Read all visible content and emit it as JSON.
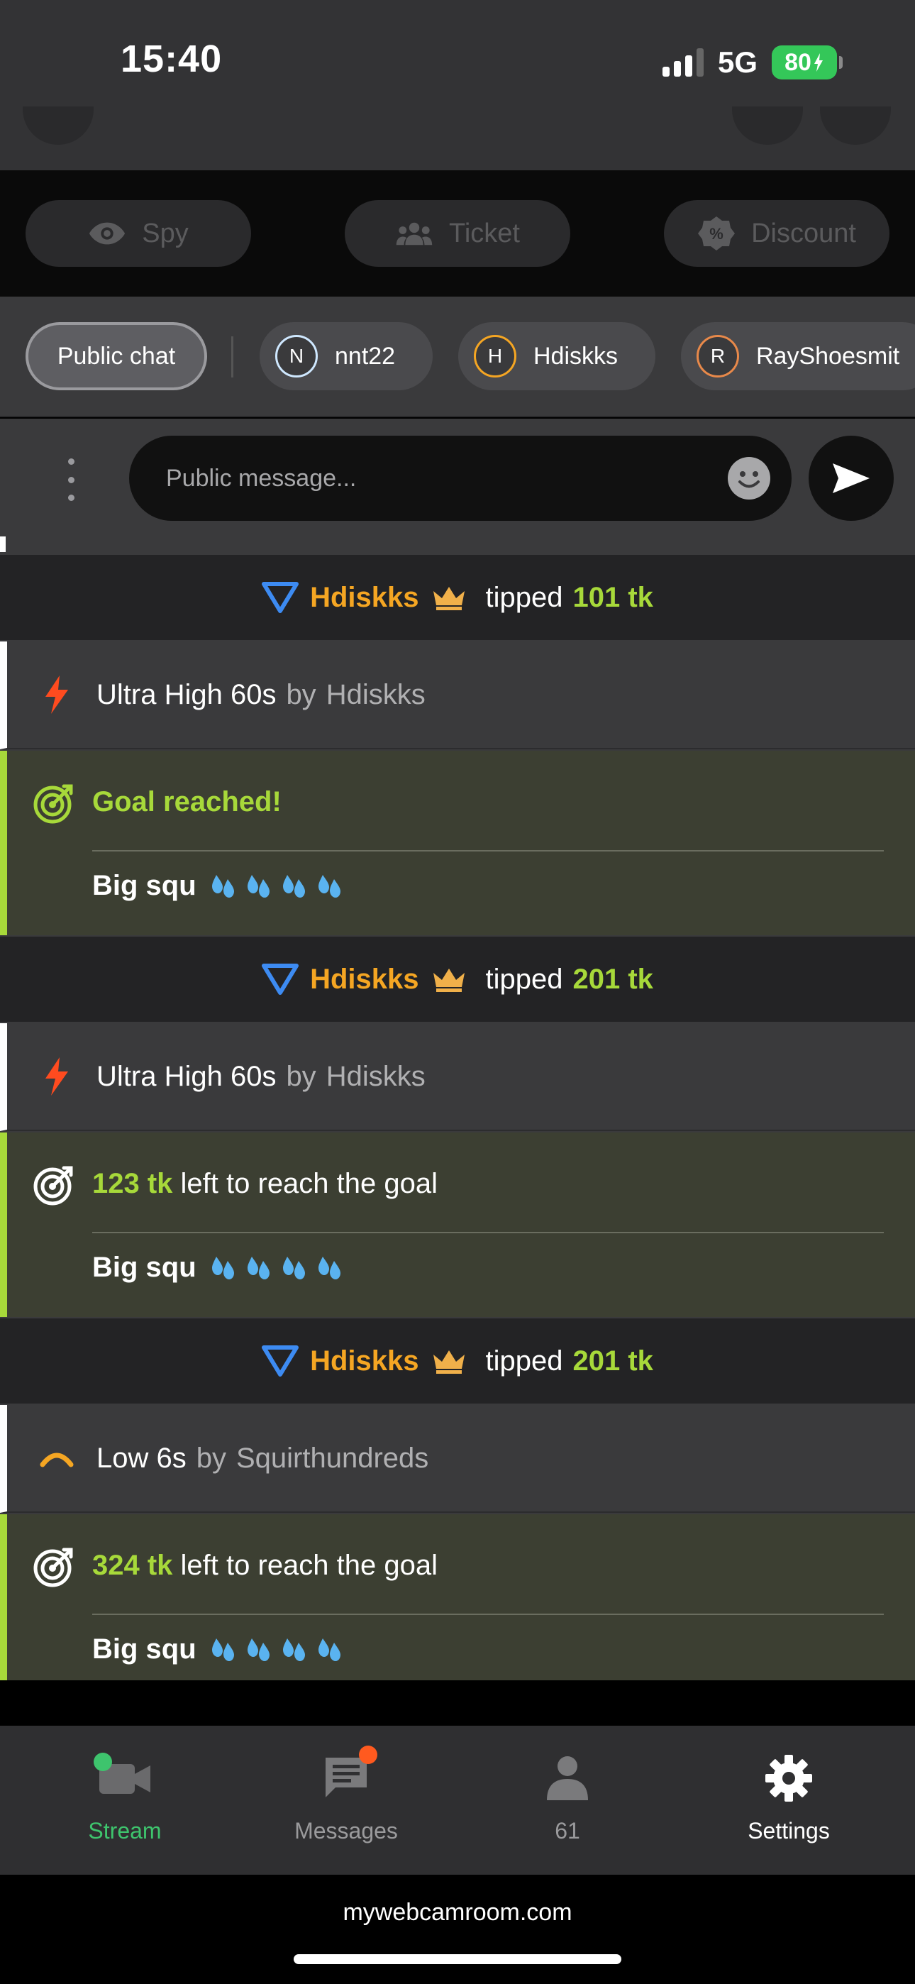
{
  "status_bar": {
    "time": "15:40",
    "network": "5G",
    "battery": "80"
  },
  "actions": {
    "spy": "Spy",
    "ticket": "Ticket",
    "discount": "Discount"
  },
  "chat_tabs": {
    "public": "Public chat",
    "users": [
      {
        "initial": "N",
        "name": "nnt22",
        "color": "#cfe8ff"
      },
      {
        "initial": "H",
        "name": "Hdiskks",
        "color": "#f5a623"
      },
      {
        "initial": "R",
        "name": "RayShoesmit",
        "color": "#e8894a"
      }
    ]
  },
  "composer": {
    "placeholder": "Public message..."
  },
  "feed": {
    "tip1": {
      "user": "Hdiskks",
      "tipped": "tipped",
      "amount": "101 tk"
    },
    "level1": {
      "level": "Ultra High 60s",
      "by": "by",
      "user": "Hdiskks"
    },
    "goal1": {
      "title": "Goal reached!",
      "desc": "Big squ"
    },
    "tip2": {
      "user": "Hdiskks",
      "tipped": "tipped",
      "amount": "201 tk"
    },
    "level2": {
      "level": "Ultra High 60s",
      "by": "by",
      "user": "Hdiskks"
    },
    "goal2": {
      "amount": "123 tk",
      "rest": "left to reach the goal",
      "desc": "Big squ"
    },
    "tip3": {
      "user": "Hdiskks",
      "tipped": "tipped",
      "amount": "201 tk"
    },
    "level3": {
      "level": "Low 6s",
      "by": "by",
      "user": "Squirthundreds"
    },
    "goal3": {
      "amount": "324 tk",
      "rest": "left to reach the goal",
      "desc": "Big squ"
    }
  },
  "nav": {
    "stream": "Stream",
    "messages": "Messages",
    "viewers": "61",
    "settings": "Settings"
  },
  "browser": {
    "url": "mywebcamroom.com"
  },
  "colors": {
    "accent_green": "#a7d93a",
    "username_orange": "#f5a623",
    "stream_green": "#3ec46d",
    "notification_orange": "#ff5a1f"
  }
}
